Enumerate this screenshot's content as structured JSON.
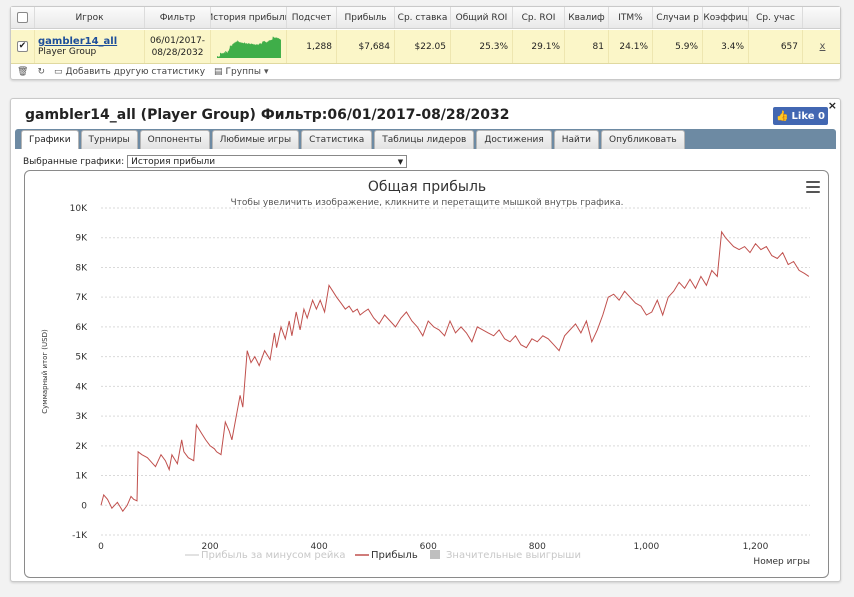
{
  "stats_table": {
    "headers": [
      "Игрок",
      "Фильтр",
      "История прибыли",
      "Подсчет",
      "Прибыль",
      "Ср. ставка",
      "Общий ROI",
      "Ср. ROI",
      "Квалиф",
      "ITM%",
      "Случаи р",
      "Коэффиц",
      "Ср. учас"
    ],
    "row": {
      "checked": true,
      "player_name": "gambler14_all",
      "player_group": "Player Group",
      "filter_line1": "06/01/2017-",
      "filter_line2": "08/28/2032",
      "count": "1,288",
      "profit": "$7,684",
      "avg_stake": "$22.05",
      "total_roi": "25.3%",
      "avg_roi": "29.1%",
      "qualif": "81",
      "itm": "24.1%",
      "cases": "5.9%",
      "coeff": "3.4%",
      "avg_part": "657",
      "remove_label": "x"
    },
    "sparkline_color": "#3fae49"
  },
  "toolbar": {
    "add_stat_label": "Добавить другую статистику",
    "groups_label": "Группы"
  },
  "panel": {
    "title": "gambler14_all (Player Group) Фильтр:06/01/2017-08/28/2032",
    "like_label": "Like 0",
    "close_label": "×"
  },
  "tabs": [
    {
      "label": "Графики",
      "active": true
    },
    {
      "label": "Турниры",
      "active": false
    },
    {
      "label": "Оппоненты",
      "active": false
    },
    {
      "label": "Любимые игры",
      "active": false
    },
    {
      "label": "Статистика",
      "active": false
    },
    {
      "label": "Таблицы лидеров",
      "active": false
    },
    {
      "label": "Достижения",
      "active": false
    },
    {
      "label": "Найти",
      "active": false
    },
    {
      "label": "Опубликовать",
      "active": false
    }
  ],
  "graph_selector": {
    "label": "Выбранные графики:",
    "value": "История прибыли"
  },
  "chart_data": {
    "type": "line",
    "title": "Общая прибыль",
    "subtitle": "Чтобы увеличить изображение, кликните и перетащите мышкой внутрь графика.",
    "xlabel": "Номер игры",
    "ylabel": "Суммарный итог (USD)",
    "xlim": [
      0,
      1300
    ],
    "ylim": [
      -1000,
      10000
    ],
    "x_ticks": [
      0,
      200,
      400,
      600,
      800,
      1000,
      1200
    ],
    "x_tick_labels": [
      "0",
      "200",
      "400",
      "600",
      "800",
      "1,000",
      "1,200"
    ],
    "y_ticks": [
      -1000,
      0,
      1000,
      2000,
      3000,
      4000,
      5000,
      6000,
      7000,
      8000,
      9000,
      10000
    ],
    "y_tick_labels": [
      "-1K",
      "0",
      "1K",
      "2K",
      "3K",
      "4K",
      "5K",
      "6K",
      "7K",
      "8K",
      "9K",
      "10K"
    ],
    "grid": true,
    "legend_position": "bottom-center",
    "series": [
      {
        "name": "Прибыль",
        "color": "#c0504d",
        "visible": true,
        "x": [
          0,
          5,
          12,
          20,
          30,
          40,
          48,
          55,
          60,
          66,
          68,
          75,
          85,
          95,
          100,
          110,
          118,
          125,
          130,
          140,
          148,
          152,
          160,
          170,
          175,
          185,
          192,
          200,
          208,
          212,
          220,
          228,
          235,
          240,
          255,
          260,
          268,
          275,
          282,
          290,
          300,
          310,
          318,
          322,
          330,
          338,
          345,
          350,
          358,
          365,
          372,
          378,
          388,
          395,
          402,
          410,
          418,
          425,
          432,
          440,
          448,
          455,
          462,
          470,
          475,
          482,
          490,
          500,
          510,
          520,
          530,
          540,
          550,
          560,
          570,
          580,
          590,
          600,
          610,
          620,
          630,
          640,
          650,
          660,
          670,
          680,
          690,
          700,
          710,
          720,
          730,
          740,
          750,
          760,
          770,
          780,
          790,
          800,
          810,
          820,
          830,
          840,
          850,
          860,
          870,
          880,
          890,
          900,
          910,
          920,
          930,
          940,
          950,
          960,
          970,
          980,
          990,
          1000,
          1010,
          1020,
          1030,
          1040,
          1050,
          1060,
          1070,
          1080,
          1090,
          1100,
          1110,
          1120,
          1130,
          1138,
          1145,
          1150,
          1160,
          1170,
          1180,
          1190,
          1200,
          1210,
          1220,
          1230,
          1240,
          1250,
          1260,
          1270,
          1280,
          1290,
          1298
        ],
        "y": [
          0,
          350,
          200,
          -100,
          100,
          -200,
          0,
          300,
          200,
          150,
          1800,
          1700,
          1600,
          1400,
          1300,
          1700,
          1500,
          1200,
          1700,
          1400,
          2200,
          1800,
          1600,
          1500,
          2700,
          2400,
          2200,
          2000,
          1900,
          1800,
          1700,
          2800,
          2500,
          2200,
          3700,
          3300,
          5200,
          4800,
          5000,
          4700,
          5200,
          4900,
          5800,
          5300,
          6000,
          5600,
          6200,
          5700,
          6500,
          5900,
          6600,
          6300,
          6900,
          6600,
          6900,
          6500,
          7400,
          7200,
          7000,
          6800,
          6600,
          6700,
          6500,
          6600,
          6400,
          6500,
          6600,
          6300,
          6100,
          6400,
          6200,
          6000,
          6300,
          6500,
          6200,
          6000,
          5700,
          6200,
          6000,
          5900,
          5700,
          6200,
          5800,
          6000,
          5800,
          5500,
          6000,
          5900,
          5800,
          5700,
          5900,
          5600,
          5500,
          5700,
          5400,
          5300,
          5600,
          5500,
          5700,
          5600,
          5400,
          5200,
          5700,
          5900,
          6100,
          5800,
          6200,
          5500,
          5900,
          6400,
          7000,
          7100,
          6900,
          7200,
          7000,
          6800,
          6700,
          6400,
          6500,
          6900,
          6400,
          7000,
          7200,
          7500,
          7300,
          7600,
          7300,
          7700,
          7400,
          7900,
          7700,
          9200,
          9000,
          8900,
          8700,
          8600,
          8700,
          8500,
          8800,
          8600,
          8700,
          8400,
          8300,
          8500,
          8100,
          8200,
          7900,
          7800,
          7700
        ]
      },
      {
        "name": "Прибыль за минусом рейка",
        "color": "#d8d8d8",
        "visible": false
      },
      {
        "name": "Значительные выигрыши",
        "color": "#bfbfbf",
        "visible": false
      }
    ]
  }
}
